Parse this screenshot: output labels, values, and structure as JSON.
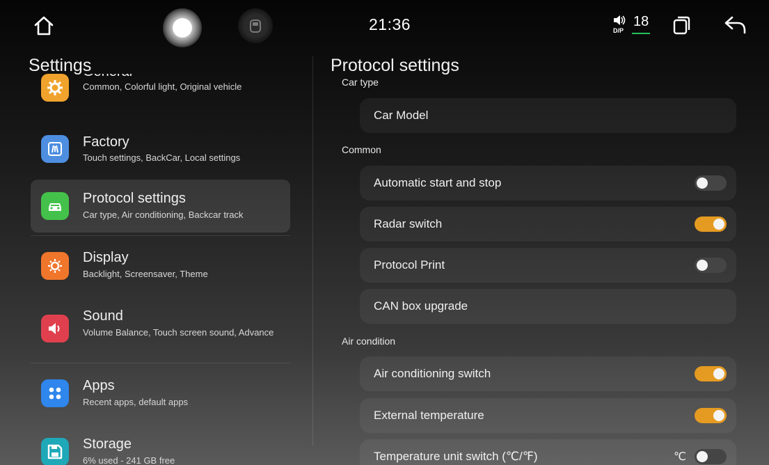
{
  "status_bar": {
    "time": "21:36",
    "volume": "18",
    "volume_icon": "speaker-dsp-icon",
    "accent_color": "#25c35a"
  },
  "left_panel": {
    "title": "Settings",
    "items": [
      {
        "label": "General",
        "subtitle": "Common, Colorful light, Original vehicle",
        "icon": "gear-icon",
        "color": "#f0a32c"
      },
      {
        "label": "Factory",
        "subtitle": "Touch settings, BackCar, Local settings",
        "icon": "factory-icon",
        "color": "#4d8ee0"
      },
      {
        "label": "Protocol settings",
        "subtitle": "Car type, Air conditioning, Backcar track",
        "icon": "car-icon",
        "color": "#44c14a",
        "selected": true
      },
      {
        "label": "Display",
        "subtitle": "Backlight, Screensaver, Theme",
        "icon": "brightness-icon",
        "color": "#f0762c"
      },
      {
        "label": "Sound",
        "subtitle": "Volume Balance, Touch screen sound, Advance",
        "icon": "speaker-icon",
        "color": "#e0404e"
      },
      {
        "label": "Apps",
        "subtitle": "Recent apps, default apps",
        "icon": "apps-grid-icon",
        "color": "#2f86ec"
      },
      {
        "label": "Storage",
        "subtitle": "6% used - 241 GB free",
        "icon": "save-disk-icon",
        "color": "#1fa8b8"
      }
    ]
  },
  "right_panel": {
    "title": "Protocol settings",
    "sections": {
      "car_type": {
        "label": "Car type",
        "rows": [
          {
            "label": "Car Model"
          }
        ]
      },
      "common": {
        "label": "Common",
        "rows": [
          {
            "label": "Automatic start and stop",
            "toggle": false
          },
          {
            "label": "Radar switch",
            "toggle": true
          },
          {
            "label": "Protocol Print",
            "toggle": false
          },
          {
            "label": "CAN box upgrade"
          }
        ]
      },
      "air_condition": {
        "label": "Air condition",
        "rows": [
          {
            "label": "Air conditioning switch",
            "toggle": true
          },
          {
            "label": "External temperature",
            "toggle": true
          },
          {
            "label": "Temperature unit switch (℃/℉)",
            "toggle": false,
            "value": "℃"
          }
        ]
      }
    },
    "toggle_on_color": "#e59b21"
  }
}
